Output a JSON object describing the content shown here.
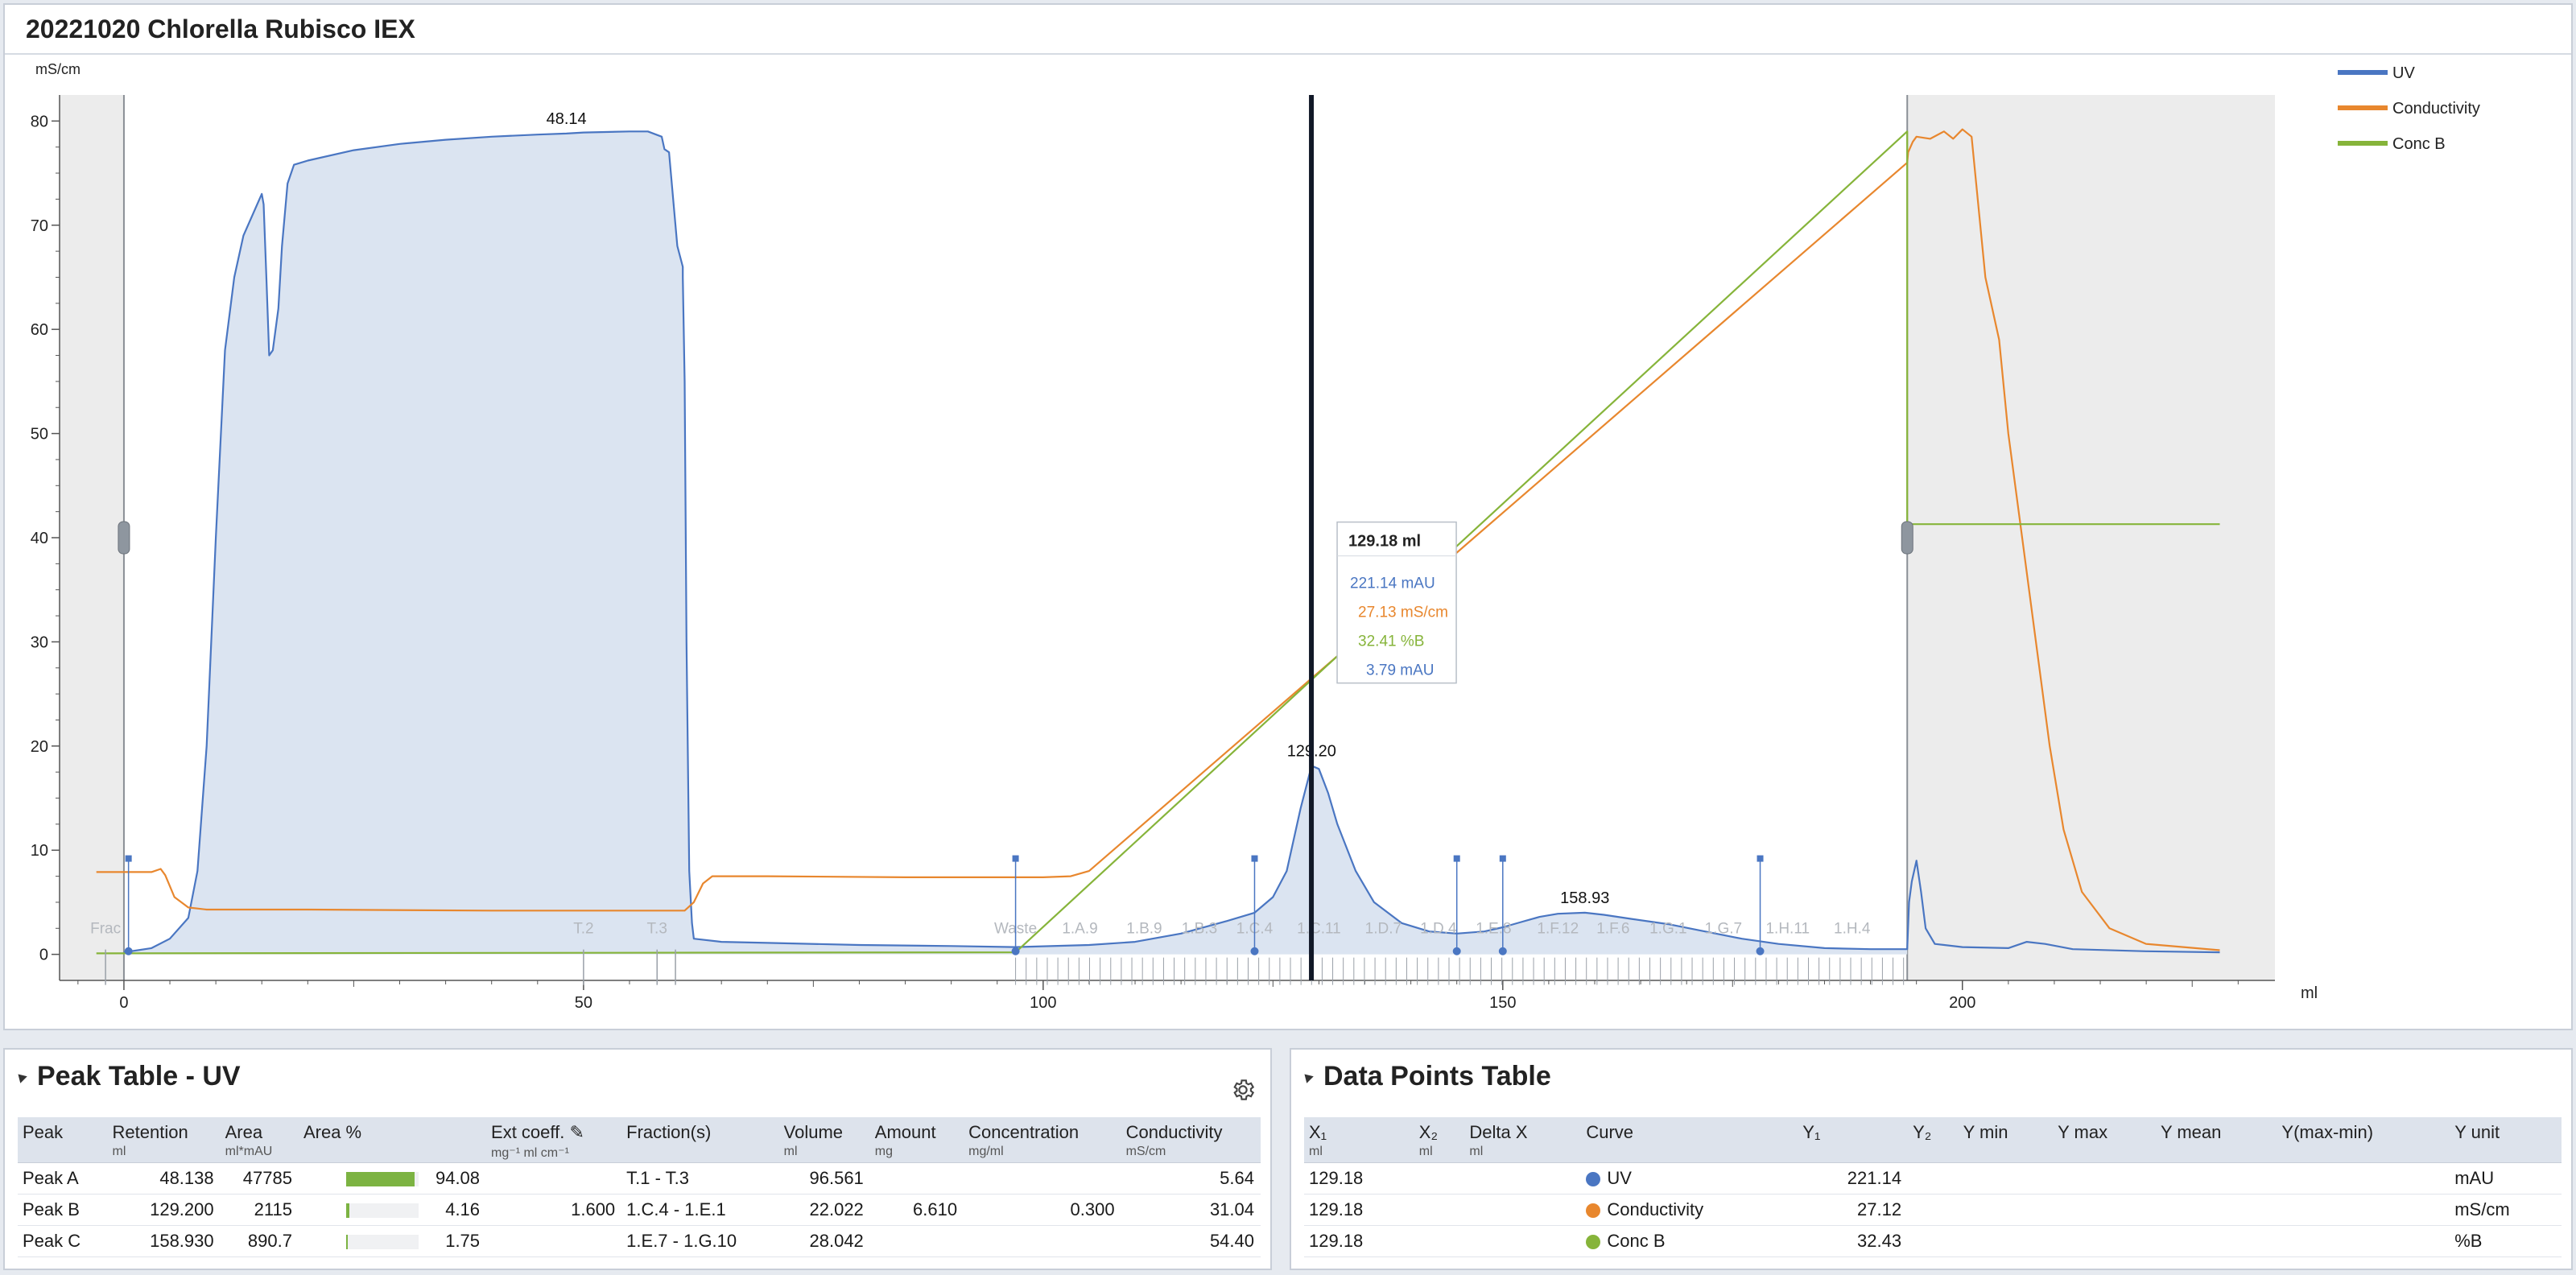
{
  "chart_title": "20221020 Chlorella Rubisco IEX",
  "colors": {
    "uv": "#4a76c2",
    "conductivity": "#e8872e",
    "concb": "#86b43a",
    "uv_fill": "#dbe4f1",
    "shade": "#ececec",
    "cursor": "#111827"
  },
  "chart_data": {
    "type": "line",
    "y_axis_unit": "mS/cm",
    "x_axis_unit": "ml",
    "xlim": [
      -7,
      234
    ],
    "ylim": [
      -2.5,
      82.5
    ],
    "y_ticks": [
      "0",
      "10",
      "20",
      "30",
      "40",
      "50",
      "60",
      "70",
      "80"
    ],
    "x_ticks": [
      "0",
      "50",
      "100",
      "150",
      "200"
    ],
    "legend": [
      "UV",
      "Conductivity",
      "Conc B"
    ],
    "legend_position": "top-right",
    "shaded_ranges": [
      [
        -7,
        0
      ],
      [
        194,
        234
      ]
    ],
    "series": [
      {
        "name": "UV",
        "points": [
          [
            0,
            0.2
          ],
          [
            3,
            0.6
          ],
          [
            5,
            1.5
          ],
          [
            7,
            3.5
          ],
          [
            8,
            8
          ],
          [
            9,
            20
          ],
          [
            10,
            40
          ],
          [
            11,
            58
          ],
          [
            12,
            65
          ],
          [
            13,
            69
          ],
          [
            14,
            71
          ],
          [
            15,
            73
          ],
          [
            15.2,
            72
          ],
          [
            15.5,
            65
          ],
          [
            15.8,
            57.5
          ],
          [
            16.2,
            58
          ],
          [
            16.8,
            62
          ],
          [
            17.2,
            68
          ],
          [
            17.8,
            74
          ],
          [
            18.5,
            75.8
          ],
          [
            20,
            76.2
          ],
          [
            25,
            77.2
          ],
          [
            30,
            77.8
          ],
          [
            35,
            78.2
          ],
          [
            40,
            78.5
          ],
          [
            45,
            78.7
          ],
          [
            48.14,
            78.8
          ],
          [
            50,
            78.9
          ],
          [
            55,
            79
          ],
          [
            57,
            79
          ],
          [
            58.5,
            78.5
          ],
          [
            58.8,
            77.3
          ],
          [
            59.3,
            77
          ],
          [
            59.8,
            72
          ],
          [
            60.2,
            68
          ],
          [
            60.8,
            66
          ],
          [
            60.8,
            65
          ],
          [
            61,
            55
          ],
          [
            61.2,
            30
          ],
          [
            61.5,
            8
          ],
          [
            61.8,
            3
          ],
          [
            62,
            1.5
          ],
          [
            65,
            1.2
          ],
          [
            70,
            1.1
          ],
          [
            80,
            0.9
          ],
          [
            90,
            0.8
          ],
          [
            97,
            0.7
          ],
          [
            105,
            0.9
          ],
          [
            110,
            1.2
          ],
          [
            115,
            2
          ],
          [
            120,
            3.2
          ],
          [
            123,
            4
          ],
          [
            125,
            5.5
          ],
          [
            126.5,
            8
          ],
          [
            128,
            14
          ],
          [
            129.2,
            18.1
          ],
          [
            130,
            17.8
          ],
          [
            131,
            15.5
          ],
          [
            132,
            12.5
          ],
          [
            134,
            8
          ],
          [
            136,
            5
          ],
          [
            139,
            3
          ],
          [
            142,
            2.2
          ],
          [
            145,
            2
          ],
          [
            148,
            2.2
          ],
          [
            150,
            2.6
          ],
          [
            152,
            3.1
          ],
          [
            154,
            3.6
          ],
          [
            156,
            3.9
          ],
          [
            158.93,
            4
          ],
          [
            161,
            3.8
          ],
          [
            164,
            3.4
          ],
          [
            168,
            2.9
          ],
          [
            172,
            2.2
          ],
          [
            176,
            1.5
          ],
          [
            180,
            1
          ],
          [
            185,
            0.6
          ],
          [
            190,
            0.5
          ],
          [
            194,
            0.5
          ],
          [
            194.2,
            5
          ],
          [
            194.5,
            7
          ],
          [
            195,
            9
          ],
          [
            195.5,
            6
          ],
          [
            196,
            2.5
          ],
          [
            197,
            1
          ],
          [
            200,
            0.7
          ],
          [
            205,
            0.6
          ],
          [
            207,
            1.2
          ],
          [
            209,
            1
          ],
          [
            212,
            0.5
          ],
          [
            220,
            0.3
          ],
          [
            228,
            0.2
          ]
        ]
      },
      {
        "name": "Conductivity",
        "points": [
          [
            -3,
            7.9
          ],
          [
            0,
            7.9
          ],
          [
            3,
            7.9
          ],
          [
            4,
            8.2
          ],
          [
            4.5,
            7.6
          ],
          [
            5.5,
            5.5
          ],
          [
            7,
            4.5
          ],
          [
            9,
            4.3
          ],
          [
            20,
            4.3
          ],
          [
            40,
            4.2
          ],
          [
            55,
            4.2
          ],
          [
            61,
            4.2
          ],
          [
            62,
            5
          ],
          [
            63,
            6.8
          ],
          [
            64,
            7.5
          ],
          [
            70,
            7.5
          ],
          [
            85,
            7.4
          ],
          [
            100,
            7.4
          ],
          [
            103,
            7.5
          ],
          [
            105,
            8
          ],
          [
            194,
            76
          ],
          [
            194.1,
            77
          ],
          [
            194.6,
            78
          ],
          [
            195,
            78.5
          ],
          [
            196.5,
            78.3
          ],
          [
            198,
            79
          ],
          [
            199,
            78.3
          ],
          [
            200,
            79.2
          ],
          [
            201,
            78.5
          ],
          [
            201.5,
            74
          ],
          [
            202.5,
            65
          ],
          [
            204,
            59
          ],
          [
            205,
            50
          ],
          [
            206.5,
            40
          ],
          [
            208,
            30
          ],
          [
            209.5,
            20
          ],
          [
            211,
            12
          ],
          [
            213,
            6
          ],
          [
            216,
            2.5
          ],
          [
            220,
            1
          ],
          [
            228,
            0.4
          ]
        ]
      },
      {
        "name": "Conc B",
        "points": [
          [
            -3,
            0.1
          ],
          [
            97,
            0.2
          ],
          [
            194,
            79
          ],
          [
            194,
            41.3
          ],
          [
            216,
            41.3
          ],
          [
            228,
            41.3
          ]
        ]
      }
    ],
    "peak_labels": [
      {
        "x": 48.14,
        "y": 78.8,
        "text": "48.14"
      },
      {
        "x": 129.2,
        "y": 18.1,
        "text": "129.20"
      },
      {
        "x": 158.93,
        "y": 4,
        "text": "158.93"
      }
    ],
    "fractions": {
      "labels": [
        {
          "x": -2,
          "text": "Frac"
        },
        {
          "x": 50,
          "text": "T.2"
        },
        {
          "x": 58,
          "text": "T.3"
        },
        {
          "x": 97,
          "text": "Waste"
        },
        {
          "x": 104,
          "text": "1.A.9"
        },
        {
          "x": 111,
          "text": "1.B.9"
        },
        {
          "x": 117,
          "text": "1.B.3"
        },
        {
          "x": 123,
          "text": "1.C.4"
        },
        {
          "x": 130,
          "text": "1.C.11"
        },
        {
          "x": 137,
          "text": "1.D.7"
        },
        {
          "x": 143,
          "text": "1.D.4"
        },
        {
          "x": 149,
          "text": "1.E.8"
        },
        {
          "x": 156,
          "text": "1.F.12"
        },
        {
          "x": 162,
          "text": "1.F.6"
        },
        {
          "x": 168,
          "text": "1.G.1"
        },
        {
          "x": 174,
          "text": "1.G.7"
        },
        {
          "x": 181,
          "text": "1.H.11"
        },
        {
          "x": 188,
          "text": "1.H.4"
        }
      ],
      "markers": [
        0.5,
        97,
        123,
        145,
        150,
        178
      ]
    },
    "cursor": {
      "x": 129.18,
      "header": "129.18 ml",
      "values": [
        {
          "text": "221.14 mAU",
          "series": "uv"
        },
        {
          "text": "27.13 mS/cm",
          "series": "conductivity"
        },
        {
          "text": "32.41 %B",
          "series": "concb"
        },
        {
          "text": "3.79 mAU",
          "series": "uv"
        }
      ]
    }
  },
  "peak_table": {
    "title": "Peak Table - UV",
    "headers": [
      {
        "label": "Peak",
        "unit": ""
      },
      {
        "label": "Retention",
        "unit": "ml"
      },
      {
        "label": "Area",
        "unit": "ml*mAU"
      },
      {
        "label": "Area %",
        "unit": ""
      },
      {
        "label": "Ext coeff.",
        "unit": "mg⁻¹ ml cm⁻¹"
      },
      {
        "label": "Fraction(s)",
        "unit": ""
      },
      {
        "label": "Volume",
        "unit": "ml"
      },
      {
        "label": "Amount",
        "unit": "mg"
      },
      {
        "label": "Concentration",
        "unit": "mg/ml"
      },
      {
        "label": "Conductivity",
        "unit": "mS/cm"
      }
    ],
    "rows": [
      {
        "peak": "Peak A",
        "retention": "48.138",
        "area": "47785",
        "area_pct": "94.08",
        "area_frac": 0.9408,
        "ext": "",
        "fractions": "T.1 - T.3",
        "volume": "96.561",
        "amount": "",
        "conc": "",
        "cond": "5.64"
      },
      {
        "peak": "Peak B",
        "retention": "129.200",
        "area": "2115",
        "area_pct": "4.16",
        "area_frac": 0.0416,
        "ext": "1.600",
        "fractions": "1.C.4 - 1.E.1",
        "volume": "22.022",
        "amount": "6.610",
        "conc": "0.300",
        "cond": "31.04"
      },
      {
        "peak": "Peak C",
        "retention": "158.930",
        "area": "890.7",
        "area_pct": "1.75",
        "area_frac": 0.0175,
        "ext": "",
        "fractions": "1.E.7 - 1.G.10",
        "volume": "28.042",
        "amount": "",
        "conc": "",
        "cond": "54.40"
      }
    ]
  },
  "data_points_table": {
    "title": "Data Points Table",
    "headers": [
      {
        "label": "X₁",
        "unit": "ml"
      },
      {
        "label": "X₂",
        "unit": "ml"
      },
      {
        "label": "Delta X",
        "unit": "ml"
      },
      {
        "label": "Curve",
        "unit": ""
      },
      {
        "label": "Y₁",
        "unit": ""
      },
      {
        "label": "Y₂",
        "unit": ""
      },
      {
        "label": "Y min",
        "unit": ""
      },
      {
        "label": "Y max",
        "unit": ""
      },
      {
        "label": "Y mean",
        "unit": ""
      },
      {
        "label": "Y(max-min)",
        "unit": ""
      },
      {
        "label": "Y unit",
        "unit": ""
      }
    ],
    "rows": [
      {
        "x1": "129.18",
        "x2": "",
        "dx": "",
        "curve": "UV",
        "color": "#4a76c2",
        "y1": "221.14",
        "y2": "",
        "ymin": "",
        "ymax": "",
        "ymean": "",
        "yrange": "",
        "yunit": "mAU"
      },
      {
        "x1": "129.18",
        "x2": "",
        "dx": "",
        "curve": "Conductivity",
        "color": "#e8872e",
        "y1": "27.12",
        "y2": "",
        "ymin": "",
        "ymax": "",
        "ymean": "",
        "yrange": "",
        "yunit": "mS/cm"
      },
      {
        "x1": "129.18",
        "x2": "",
        "dx": "",
        "curve": "Conc B",
        "color": "#86b43a",
        "y1": "32.43",
        "y2": "",
        "ymin": "",
        "ymax": "",
        "ymean": "",
        "yrange": "",
        "yunit": "%B"
      }
    ]
  }
}
